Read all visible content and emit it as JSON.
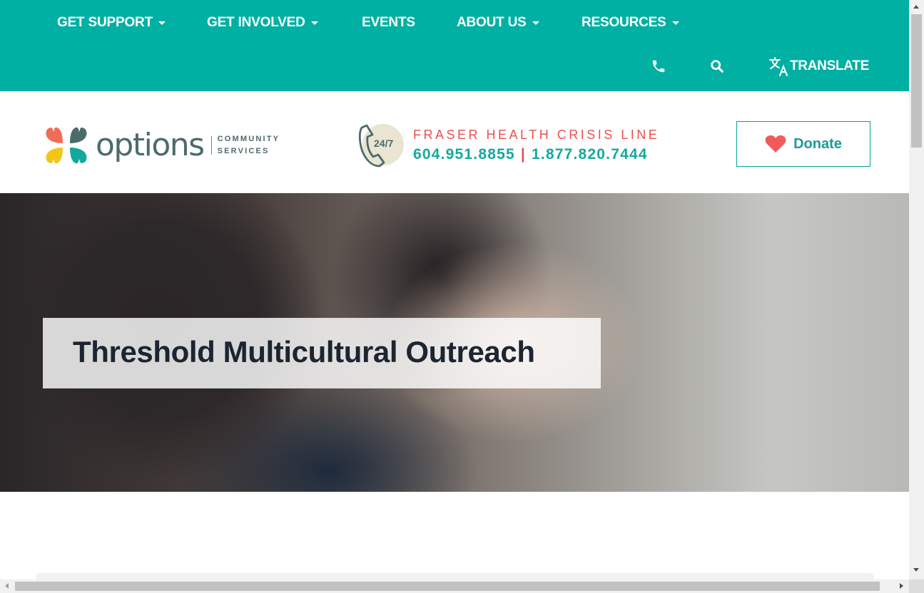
{
  "nav": {
    "items": [
      {
        "label": "GET SUPPORT",
        "has_dropdown": true
      },
      {
        "label": "GET INVOLVED",
        "has_dropdown": true
      },
      {
        "label": "EVENTS",
        "has_dropdown": false
      },
      {
        "label": "ABOUT US",
        "has_dropdown": true
      },
      {
        "label": "RESOURCES",
        "has_dropdown": true
      }
    ],
    "phone_icon": "phone-icon",
    "search_icon": "search-icon",
    "translate_icon": "translate-icon",
    "translate_label": "TRANSLATE"
  },
  "header": {
    "logo": {
      "wordmark": "options",
      "line1": "COMMUNITY",
      "line2": "SERVICES"
    },
    "crisis": {
      "badge": "24/7",
      "title": "FRASER HEALTH CRISIS LINE",
      "phone_local": "604.951.8855",
      "separator": "|",
      "phone_toll_free": "1.877.820.7444"
    },
    "donate_label": "Donate",
    "donate_icon": "heart-icon"
  },
  "hero": {
    "title": "Threshold Multicultural Outreach"
  },
  "colors": {
    "brand_teal": "#00b0a3",
    "crisis_red": "#e8514f",
    "number_teal": "#15a99d",
    "heart": "#f05a5a",
    "logo_gray": "#4d6a6c"
  }
}
